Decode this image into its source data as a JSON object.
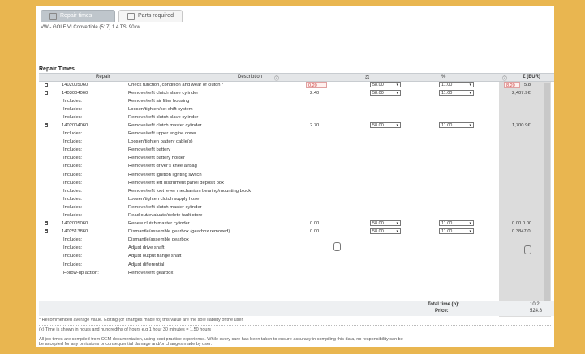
{
  "tabs": [
    {
      "label": "Repair times",
      "active": true
    },
    {
      "label": "Parts required",
      "active": false
    }
  ],
  "vehicle": "VW - GOLF VI Convertible (517) 1.4 TSI 90kw",
  "section_title": "Repair Times",
  "columns": {
    "repair": "Repair",
    "description": "Description",
    "col3": "",
    "col4": "",
    "col5": "",
    "sum": "Σ (EUR)"
  },
  "rows": [
    {
      "code": "1402005060",
      "desc": "Check function, condition and wear of clutch *",
      "value": "0.20",
      "sel1": "58.00",
      "sel2": "11.00",
      "amount": "8.20",
      "amount2": "5.8",
      "trash": true
    },
    {
      "code": "1403004060",
      "desc": "Remove/refit clutch slave cylinder",
      "value": "2.40",
      "sel1": "58.00",
      "sel2": "11.00",
      "amount": "2,407.9€",
      "trash": true
    },
    {
      "code": "Includes:",
      "desc": "Remove/refit air filter housing"
    },
    {
      "code": "Includes:",
      "desc": "Loosen/tighten/set shift system"
    },
    {
      "code": "Includes:",
      "desc": "Remove/refit clutch slave cylinder"
    },
    {
      "code": "1402004060",
      "desc": "Remove/refit clutch master cylinder",
      "value": "2.70",
      "sel1": "58.00",
      "sel2": "11.00",
      "amount": "1,700.9€",
      "trash": true
    },
    {
      "code": "Includes:",
      "desc": "Remove/refit upper engine cover"
    },
    {
      "code": "Includes:",
      "desc": "Loosen/tighten battery cable(s)"
    },
    {
      "code": "Includes:",
      "desc": "Remove/refit battery"
    },
    {
      "code": "Includes:",
      "desc": "Remove/refit battery holder"
    },
    {
      "code": "Includes:",
      "desc": "Remove/refit driver's knee airbag"
    },
    {
      "code": "Includes:",
      "desc": "Remove/refit ignition lighting switch"
    },
    {
      "code": "Includes:",
      "desc": "Remove/refit left instrument panel deposit box"
    },
    {
      "code": "Includes:",
      "desc": "Remove/refit foot lever mechanism bearing/mounting block"
    },
    {
      "code": "Includes:",
      "desc": "Loosen/tighten clutch supply hose"
    },
    {
      "code": "Includes:",
      "desc": "Remove/refit clutch master cylinder"
    },
    {
      "code": "Includes:",
      "desc": "Read out/evaluate/delete fault store"
    },
    {
      "code": "1402005060",
      "desc": "Renew clutch master cylinder",
      "value": "0.00",
      "sel1": "58.00",
      "sel2": "11.00",
      "amount": "0.00 0.00",
      "trash": true
    },
    {
      "code": "1402513860",
      "desc": "Dismantle/assemble gearbox (gearbox removed)",
      "value": "0.00",
      "sel1": "58.00",
      "sel2": "11.00",
      "amount": "0.3847.0",
      "trash": true
    },
    {
      "code": "Includes:",
      "desc": "Dismantle/assemble gearbox"
    },
    {
      "code": "Includes:",
      "desc": "Adjust drive shaft"
    },
    {
      "code": "Includes:",
      "desc": "Adjust output flange shaft"
    },
    {
      "code": "Includes:",
      "desc": "Adjust differential"
    },
    {
      "code": "Follow-up action:",
      "desc": "Remove/refit gearbox"
    }
  ],
  "totals": {
    "time_label": "Total time (h):",
    "time_value": "10.2",
    "price_label": "Price:",
    "price_value": "524.8"
  },
  "notes": [
    "* Recommended average value. Editing (or changes made to) this value are the sole liability of the user.",
    "(x) Time is shown in hours and hundredths of hours e.g 1 hour 30 minutes = 1.50 hours",
    "All job times are compiled from OEM documentation, using best practice experience. While every care has been taken to ensure accuracy in compiling this data, no responsibility can be",
    "be accepted for any omissions or consequential damage and/or changes made by user."
  ]
}
